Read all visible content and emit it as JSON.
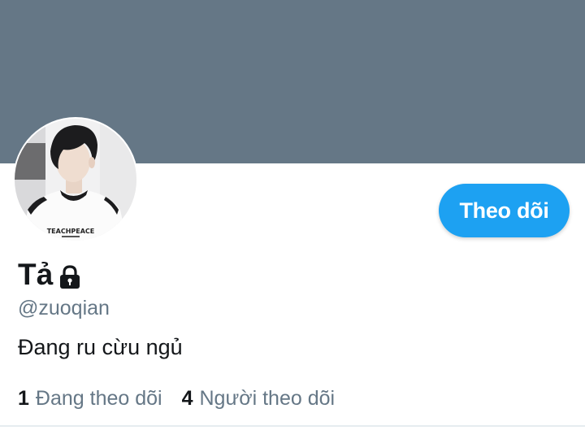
{
  "profile": {
    "display_name": "Tả",
    "handle": "@zuoqian",
    "bio": "Đang ru cừu ngủ",
    "protected_icon": "lock-icon",
    "avatar_shirt_text": "TEACHPEACE"
  },
  "actions": {
    "follow_label": "Theo dõi"
  },
  "stats": {
    "following_count": "1",
    "following_label": "Đang theo dõi",
    "followers_count": "4",
    "followers_label": "Người theo dõi"
  },
  "colors": {
    "banner": "#657786",
    "accent": "#1da1f2",
    "primary_text": "#14171a",
    "secondary_text": "#657786"
  }
}
